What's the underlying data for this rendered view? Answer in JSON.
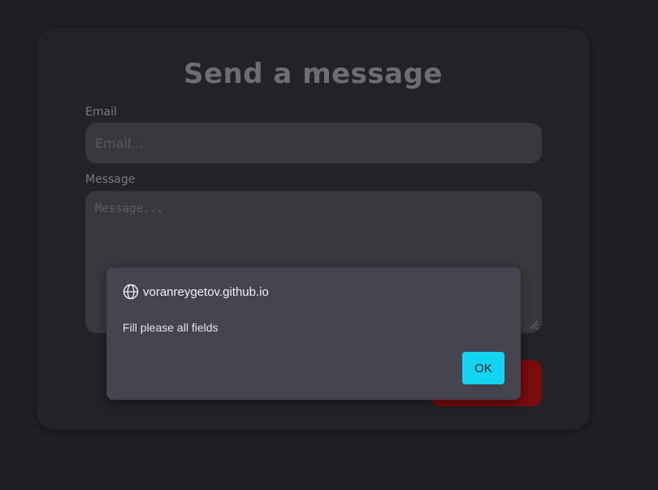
{
  "form": {
    "title": "Send a message",
    "email_label": "Email",
    "email_placeholder": "Email...",
    "message_label": "Message",
    "message_placeholder": "Message..."
  },
  "dialog": {
    "origin": "voranreygetov.github.io",
    "message": "Fill please all fields",
    "ok_label": "OK"
  },
  "colors": {
    "background": "#1e1e20",
    "card": "#232325",
    "input": "#39393b",
    "send_button": "#7a0c0c",
    "dialog": "#45434f",
    "ok_button": "#13d4f5"
  },
  "icons": {
    "origin": "globe-icon",
    "resize": "resize-grip-icon"
  }
}
